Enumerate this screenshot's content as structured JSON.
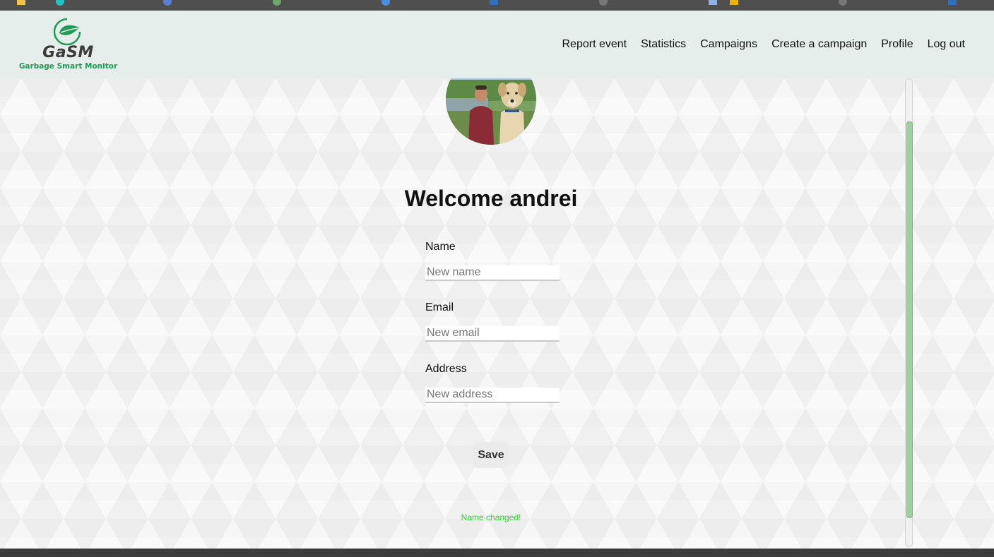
{
  "colors": {
    "header_bg": "#e6eeeb",
    "logo_green": "#1f9b55",
    "success_text": "#22dd22",
    "scrollbar_thumb": "#9fcf9f"
  },
  "logo": {
    "title": "GaSM",
    "subtitle": "Garbage Smart Monitor",
    "icon": "leaf-circle-icon"
  },
  "nav": {
    "items": [
      {
        "label": "Report event"
      },
      {
        "label": "Statistics"
      },
      {
        "label": "Campaigns"
      },
      {
        "label": "Create a campaign"
      },
      {
        "label": "Profile"
      },
      {
        "label": "Log out"
      }
    ]
  },
  "profile": {
    "welcome": "Welcome andrei",
    "avatar_icon": "user-avatar-photo"
  },
  "form": {
    "name_label": "Name",
    "name_placeholder": "New name",
    "email_label": "Email",
    "email_placeholder": "New email",
    "address_label": "Address",
    "address_placeholder": "New address",
    "save_label": "Save",
    "status_message": "Name changed!"
  }
}
